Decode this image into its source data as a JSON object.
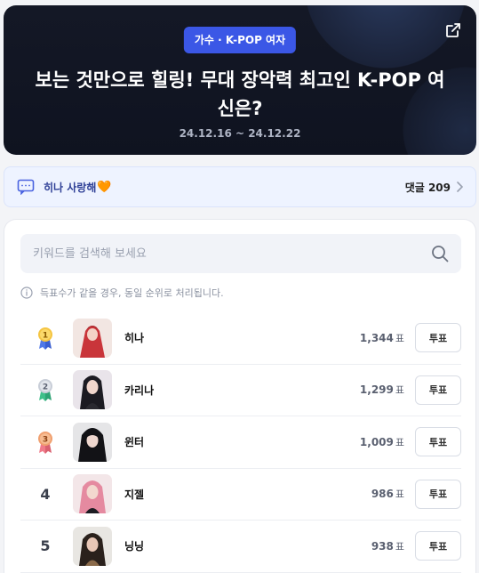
{
  "hero": {
    "tag": "가수 · K-POP 여자",
    "title": "보는 것만으로 힐링! 무대 장악력 최고인 K-POP 여신은?",
    "period": "24.12.16 ~ 24.12.22",
    "share_icon": "external-link-icon"
  },
  "comment": {
    "message": "히나 사랑해",
    "heart": "🧡",
    "count_label": "댓글 209"
  },
  "search": {
    "placeholder": "키워드를 검색해 보세요"
  },
  "notice": "득표수가 같을 경우, 동일 순위로 처리됩니다.",
  "rankings": [
    {
      "rank": "1",
      "name": "히나",
      "votes": "1,344",
      "unit": "표",
      "button": "투표",
      "medal": "gold"
    },
    {
      "rank": "2",
      "name": "카리나",
      "votes": "1,299",
      "unit": "표",
      "button": "투표",
      "medal": "silver"
    },
    {
      "rank": "3",
      "name": "윈터",
      "votes": "1,009",
      "unit": "표",
      "button": "투표",
      "medal": "bronze"
    },
    {
      "rank": "4",
      "name": "지젤",
      "votes": "986",
      "unit": "표",
      "button": "투표",
      "medal": ""
    },
    {
      "rank": "5",
      "name": "닝닝",
      "votes": "938",
      "unit": "표",
      "button": "투표",
      "medal": ""
    }
  ],
  "colors": {
    "accent": "#3b57e6",
    "hero_bg": "#141826",
    "gold": "#f5c542",
    "silver": "#c9ced8",
    "bronze": "#f0a070"
  }
}
